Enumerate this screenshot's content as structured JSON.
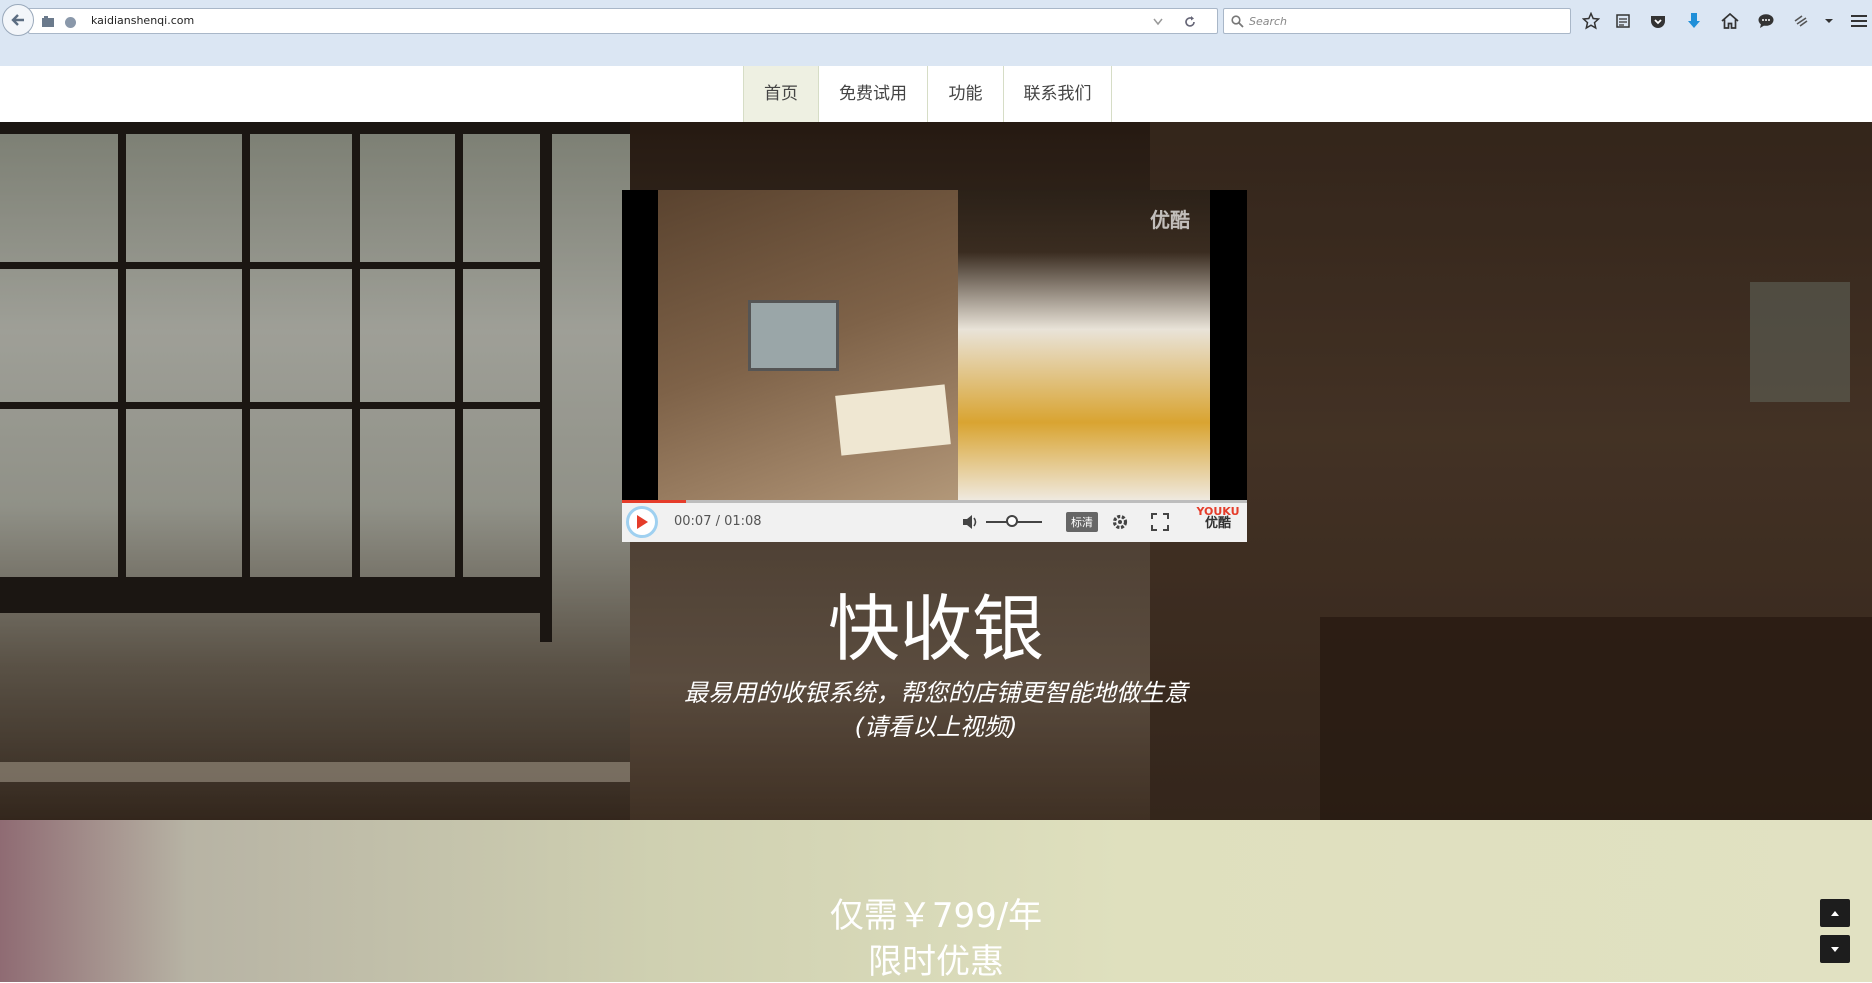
{
  "browser": {
    "url": "kaidianshenqi.com",
    "search_placeholder": "Search"
  },
  "nav": {
    "items": [
      {
        "label": "首页",
        "active": true
      },
      {
        "label": "免费试用",
        "active": false
      },
      {
        "label": "功能",
        "active": false
      },
      {
        "label": "联系我们",
        "active": false
      }
    ]
  },
  "video": {
    "watermark": "优酷",
    "time": "00:07 / 01:08",
    "progress": 0.103,
    "quality": "标清",
    "logo_en": "YOUKU",
    "logo_cn": "优酷"
  },
  "hero": {
    "title": "快收银",
    "subtitle": "最易用的收银系统，帮您的店铺更智能地做生意",
    "note": "(请看以上视频)"
  },
  "pricing": {
    "prefix": "仅需￥",
    "price": "799",
    "suffix": "/年",
    "promo": "限时优惠"
  },
  "icons": {
    "back": "back-arrow-icon",
    "bookmark": "star-icon",
    "reading_list": "reading-list-icon",
    "pocket": "pocket-icon",
    "download": "download-icon",
    "home": "home-icon",
    "chat": "chat-icon",
    "menu": "hamburger-menu-icon"
  },
  "colors": {
    "accent_red": "#e53c2a",
    "download_blue": "#1f8fd8",
    "nav_active_bg": "#eef0e2"
  }
}
